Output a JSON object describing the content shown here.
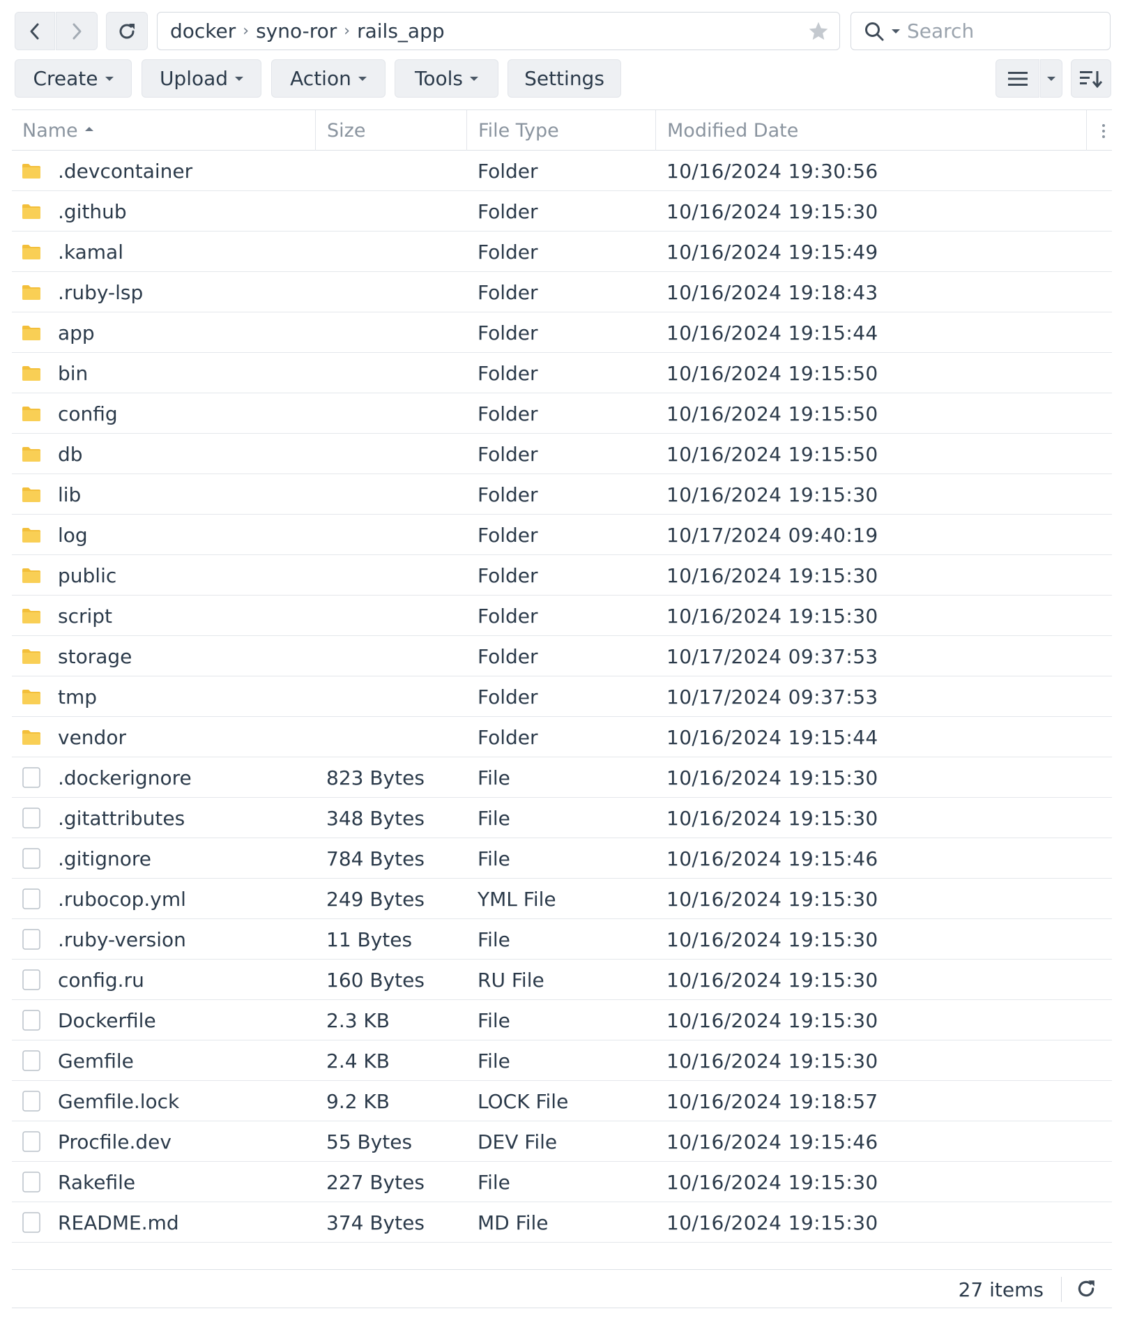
{
  "nav": {
    "back_icon": "chevron-left-icon",
    "forward_icon": "chevron-right-icon",
    "refresh_icon": "refresh-icon"
  },
  "path": {
    "segments": [
      "docker",
      "syno-ror",
      "rails_app"
    ]
  },
  "search": {
    "placeholder": "Search"
  },
  "toolbar": {
    "create": "Create",
    "upload": "Upload",
    "action": "Action",
    "tools": "Tools",
    "settings": "Settings"
  },
  "table": {
    "columns": {
      "name": "Name",
      "size": "Size",
      "type": "File Type",
      "date": "Modified Date"
    },
    "rows": [
      {
        "kind": "folder",
        "name": ".devcontainer",
        "size": "",
        "type": "Folder",
        "date": "10/16/2024 19:30:56"
      },
      {
        "kind": "folder",
        "name": ".github",
        "size": "",
        "type": "Folder",
        "date": "10/16/2024 19:15:30"
      },
      {
        "kind": "folder",
        "name": ".kamal",
        "size": "",
        "type": "Folder",
        "date": "10/16/2024 19:15:49"
      },
      {
        "kind": "folder",
        "name": ".ruby-lsp",
        "size": "",
        "type": "Folder",
        "date": "10/16/2024 19:18:43"
      },
      {
        "kind": "folder",
        "name": "app",
        "size": "",
        "type": "Folder",
        "date": "10/16/2024 19:15:44"
      },
      {
        "kind": "folder",
        "name": "bin",
        "size": "",
        "type": "Folder",
        "date": "10/16/2024 19:15:50"
      },
      {
        "kind": "folder",
        "name": "config",
        "size": "",
        "type": "Folder",
        "date": "10/16/2024 19:15:50"
      },
      {
        "kind": "folder",
        "name": "db",
        "size": "",
        "type": "Folder",
        "date": "10/16/2024 19:15:50"
      },
      {
        "kind": "folder",
        "name": "lib",
        "size": "",
        "type": "Folder",
        "date": "10/16/2024 19:15:30"
      },
      {
        "kind": "folder",
        "name": "log",
        "size": "",
        "type": "Folder",
        "date": "10/17/2024 09:40:19"
      },
      {
        "kind": "folder",
        "name": "public",
        "size": "",
        "type": "Folder",
        "date": "10/16/2024 19:15:30"
      },
      {
        "kind": "folder",
        "name": "script",
        "size": "",
        "type": "Folder",
        "date": "10/16/2024 19:15:30"
      },
      {
        "kind": "folder",
        "name": "storage",
        "size": "",
        "type": "Folder",
        "date": "10/17/2024 09:37:53"
      },
      {
        "kind": "folder",
        "name": "tmp",
        "size": "",
        "type": "Folder",
        "date": "10/17/2024 09:37:53"
      },
      {
        "kind": "folder",
        "name": "vendor",
        "size": "",
        "type": "Folder",
        "date": "10/16/2024 19:15:44"
      },
      {
        "kind": "file",
        "name": ".dockerignore",
        "size": "823 Bytes",
        "type": "File",
        "date": "10/16/2024 19:15:30"
      },
      {
        "kind": "file",
        "name": ".gitattributes",
        "size": "348 Bytes",
        "type": "File",
        "date": "10/16/2024 19:15:30"
      },
      {
        "kind": "file",
        "name": ".gitignore",
        "size": "784 Bytes",
        "type": "File",
        "date": "10/16/2024 19:15:46"
      },
      {
        "kind": "file",
        "name": ".rubocop.yml",
        "size": "249 Bytes",
        "type": "YML File",
        "date": "10/16/2024 19:15:30"
      },
      {
        "kind": "file",
        "name": ".ruby-version",
        "size": "11 Bytes",
        "type": "File",
        "date": "10/16/2024 19:15:30"
      },
      {
        "kind": "file",
        "name": "config.ru",
        "size": "160 Bytes",
        "type": "RU File",
        "date": "10/16/2024 19:15:30"
      },
      {
        "kind": "file",
        "name": "Dockerfile",
        "size": "2.3 KB",
        "type": "File",
        "date": "10/16/2024 19:15:30"
      },
      {
        "kind": "file",
        "name": "Gemfile",
        "size": "2.4 KB",
        "type": "File",
        "date": "10/16/2024 19:15:30"
      },
      {
        "kind": "file",
        "name": "Gemfile.lock",
        "size": "9.2 KB",
        "type": "LOCK File",
        "date": "10/16/2024 19:18:57"
      },
      {
        "kind": "file",
        "name": "Procfile.dev",
        "size": "55 Bytes",
        "type": "DEV File",
        "date": "10/16/2024 19:15:46"
      },
      {
        "kind": "file",
        "name": "Rakefile",
        "size": "227 Bytes",
        "type": "File",
        "date": "10/16/2024 19:15:30"
      },
      {
        "kind": "file",
        "name": "README.md",
        "size": "374 Bytes",
        "type": "MD File",
        "date": "10/16/2024 19:15:30"
      }
    ]
  },
  "footer": {
    "count": "27 items"
  },
  "colors": {
    "folder": "#f9cf55",
    "folder_tab": "#f3bf3a",
    "file_border": "#b9c0c8",
    "button_bg": "#eef0f3"
  }
}
